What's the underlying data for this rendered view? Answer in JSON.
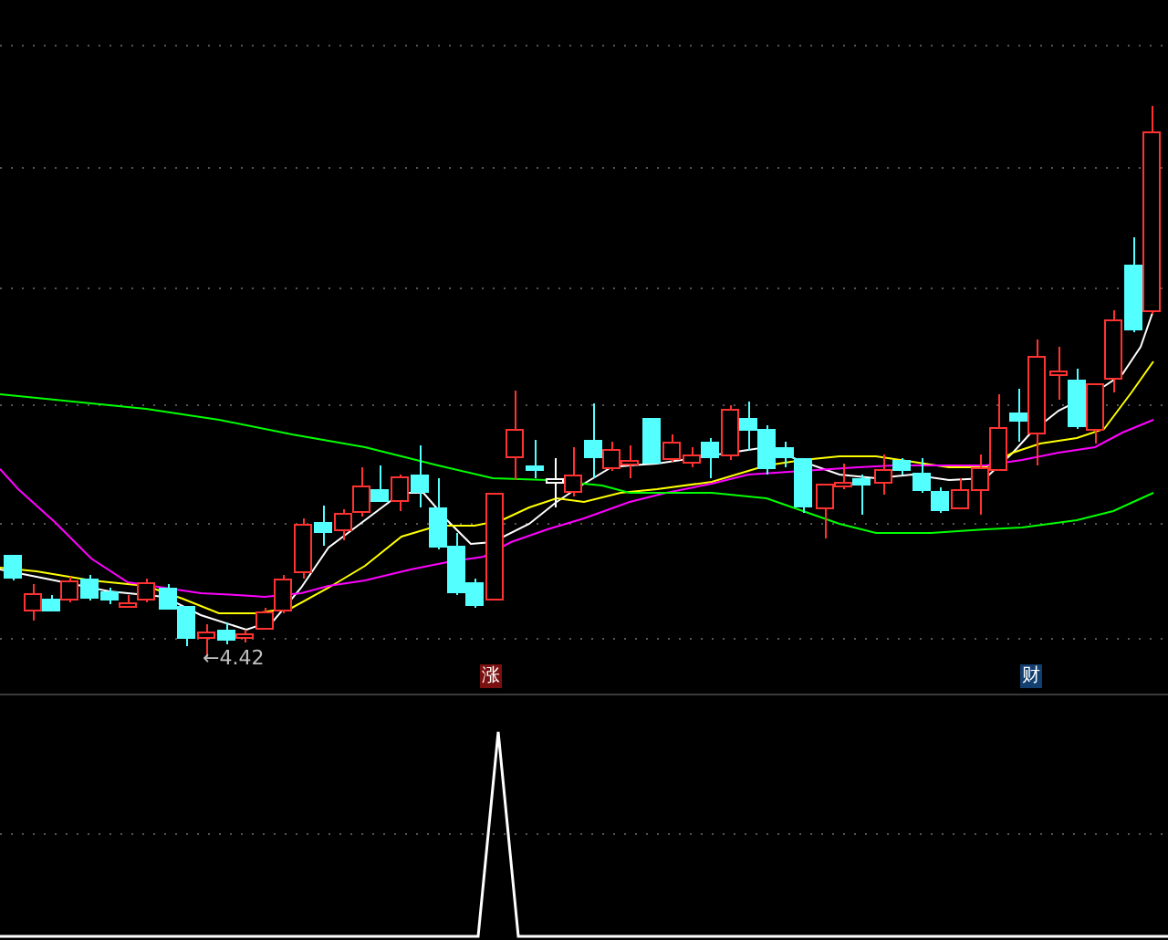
{
  "price_panel": {
    "low_label": "←4.42"
  },
  "event_markers": [
    {
      "text": "涨",
      "color": "#7a1010"
    },
    {
      "text": "财",
      "color": "#123e70"
    }
  ]
}
